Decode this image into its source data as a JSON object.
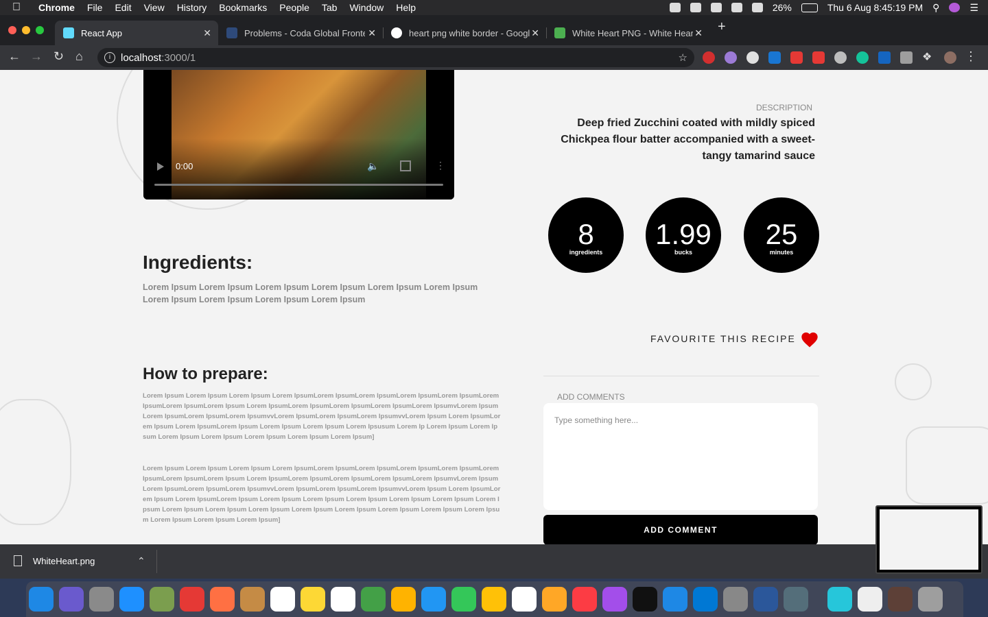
{
  "menubar": {
    "app": "Chrome",
    "items": [
      "File",
      "Edit",
      "View",
      "History",
      "Bookmarks",
      "People",
      "Tab",
      "Window",
      "Help"
    ],
    "battery": "26%",
    "datetime": "Thu 6 Aug  8:45:19 PM"
  },
  "tabs": [
    {
      "title": "React App",
      "favicon_color": "#61dafb"
    },
    {
      "title": "Problems - Coda Global Fronte",
      "favicon_color": "#2e4a7a"
    },
    {
      "title": "heart png white border - Googl",
      "favicon_color": "#ea4335"
    },
    {
      "title": "White Heart PNG - White Heart",
      "favicon_color": "#4caf50"
    }
  ],
  "omnibox": {
    "host": "localhost",
    "port_path": ":3000/1"
  },
  "video": {
    "time": "0:00"
  },
  "description": {
    "label": "DESCRIPTION",
    "text": "Deep fried Zucchini coated with mildly spiced Chickpea flour batter accompanied with a sweet-tangy tamarind sauce"
  },
  "stats": [
    {
      "value": "8",
      "label": "ingredients"
    },
    {
      "value": "1.99",
      "label": "bucks"
    },
    {
      "value": "25",
      "label": "minutes"
    }
  ],
  "ingredients": {
    "title": "Ingredients:",
    "text": "Lorem Ipsum Lorem Ipsum Lorem Ipsum Lorem Ipsum Lorem Ipsum Lorem Ipsum Lorem Ipsum Lorem Ipsum Lorem Ipsum Lorem Ipsum"
  },
  "prepare": {
    "title": "How to prepare:",
    "p1": "Lorem Ipsum Lorem Ipsum Lorem Ipsum Lorem IpsumLorem IpsumLorem IpsumLorem IpsumLorem IpsumLorem IpsumLorem IpsumLorem Ipsum Lorem IpsumLorem IpsumLorem IpsumLorem IpsumLorem IpsumvLorem IpsumLorem IpsumLorem IpsumLorem IpsumvvLorem IpsumLorem IpsumLorem IpsumvvLorem Ipsum Lorem IpsumLorem Ipsum Lorem IpsumLorem Ipsum Lorem Ipsum Lorem Ipsum Lorem Ipsusum Lorem Ip Lorem Ipsum Lorem Ipsum Lorem Ipsum Lorem Ipsum Lorem Ipsum Lorem Ipsum Lorem Ipsum]",
    "p2": "Lorem Ipsum Lorem Ipsum Lorem Ipsum Lorem IpsumLorem IpsumLorem IpsumLorem IpsumLorem IpsumLorem IpsumLorem IpsumLorem Ipsum Lorem IpsumLorem IpsumLorem IpsumLorem IpsumLorem IpsumvLorem IpsumLorem IpsumLorem IpsumLorem IpsumvvLorem IpsumLorem IpsumLorem IpsumvvLorem Ipsum Lorem IpsumLorem Ipsum Lorem IpsumLorem Ipsum Lorem Ipsum Lorem Ipsum Lorem Ipsum Lorem Ipsum Lorem Ipsum Lorem Ipsum Lorem Ipsum Lorem Ipsum Lorem Ipsum Lorem Ipsum Lorem Ipsum Lorem Ipsum Lorem Ipsum Lorem Ipsum Lorem Ipsum Lorem Ipsum Lorem Ipsum]"
  },
  "favourite": {
    "label": "FAVOURITE THIS RECIPE",
    "heart_color": "#e00000"
  },
  "comments": {
    "label": "ADD COMMENTS",
    "placeholder": "Type something here...",
    "button": "ADD COMMENT"
  },
  "download": {
    "filename": "WhiteHeart.png"
  },
  "dock_colors": [
    "#1e88e5",
    "#6a5acd",
    "#8a8a8a",
    "#1e90ff",
    "#7b9e4e",
    "#e53935",
    "#ff7043",
    "#c58b45",
    "#ffffff",
    "#fdd835",
    "#ffffff",
    "#43a047",
    "#ffb300",
    "#2196f3",
    "#34c759",
    "#ffc107",
    "#ffffff",
    "#ffa726",
    "#fc3c44",
    "#a34eea",
    "#111111",
    "#1e88e5",
    "#0078d4",
    "#888888",
    "#2b579a",
    "#546e7a",
    "#26c6da",
    "#eeeeee",
    "#5d4037",
    "#9e9e9e"
  ]
}
